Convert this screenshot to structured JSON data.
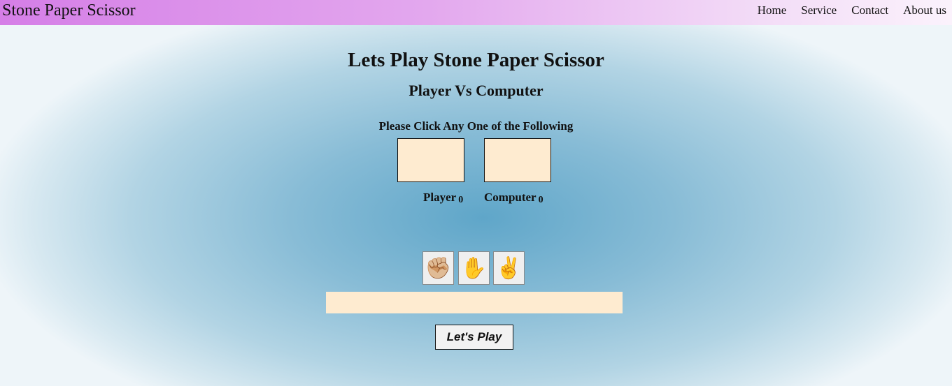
{
  "navbar": {
    "brand": "Stone Paper Scissor",
    "links": [
      "Home",
      "Service",
      "Contact",
      "About us"
    ]
  },
  "main": {
    "title": "Lets Play Stone Paper Scissor",
    "subtitle": "Player Vs Computer",
    "instruction": "Please Click Any One of the Following",
    "player_label": "Player",
    "player_score": "0",
    "computer_label": "Computer",
    "computer_score": "0",
    "result": ""
  },
  "choices": [
    {
      "name": "stone",
      "icon": "fist-icon",
      "glyph": "✊🏼"
    },
    {
      "name": "paper",
      "icon": "raised-hand-icon",
      "glyph": "✋"
    },
    {
      "name": "scissor",
      "icon": "victory-hand-icon",
      "glyph": "✌️"
    }
  ],
  "play_button": "Let's Play",
  "colors": {
    "navbar_start": "#d57ee7",
    "navbar_end": "#fbf2fc",
    "box_fill": "#feebd0",
    "background_center": "#5fa6c9"
  }
}
